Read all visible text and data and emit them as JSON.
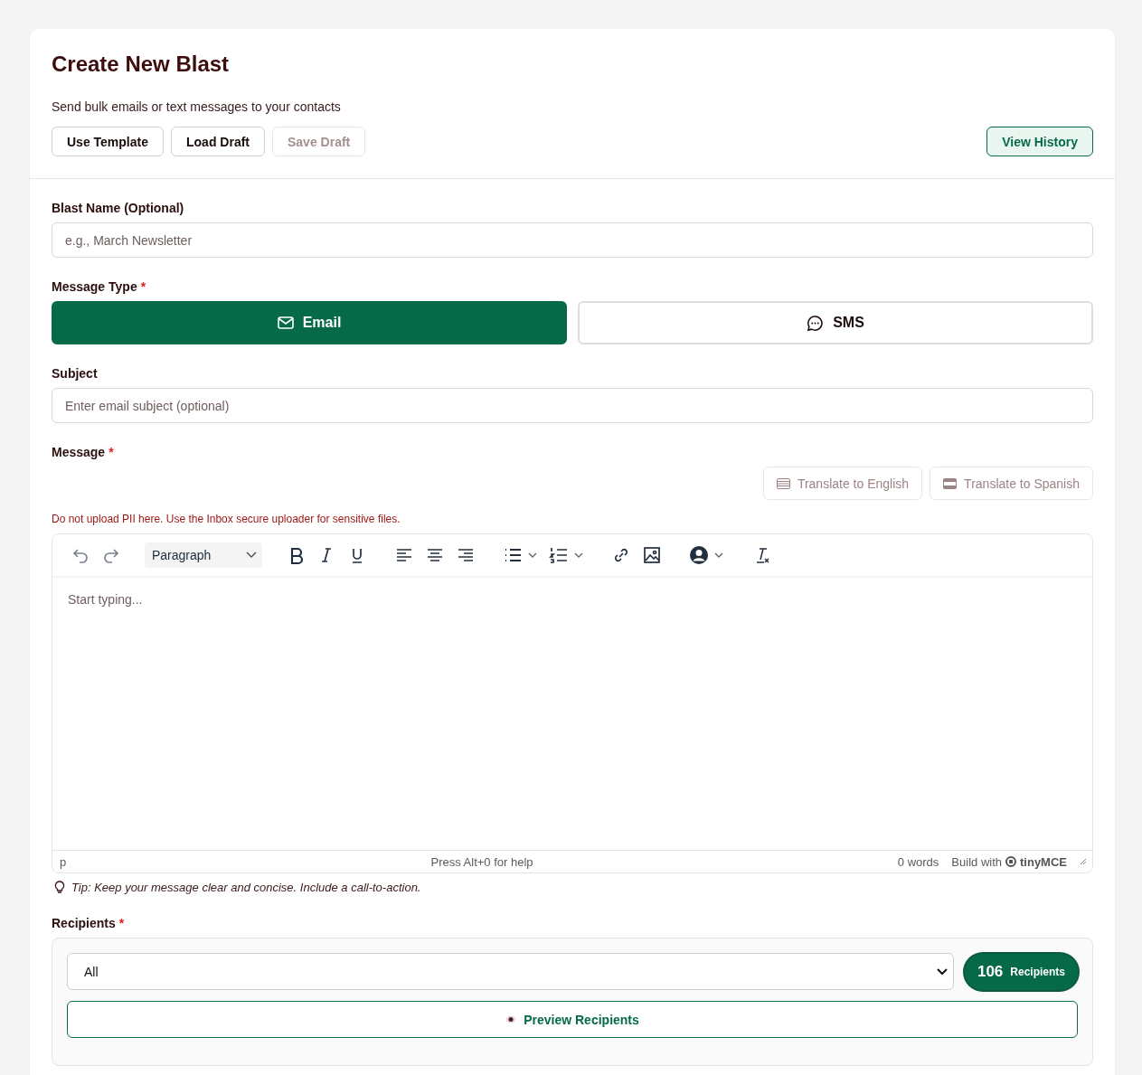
{
  "header": {
    "title": "Create New Blast",
    "subtitle": "Send bulk emails or text messages to your contacts",
    "actions": [
      {
        "label": "Use Template",
        "disabled": false
      },
      {
        "label": "Load Draft",
        "disabled": false
      },
      {
        "label": "Save Draft",
        "disabled": true
      }
    ],
    "history_button": "View History"
  },
  "blast_name": {
    "label": "Blast Name (Optional)",
    "placeholder": "e.g., March Newsletter"
  },
  "message_type": {
    "label": "Message Type",
    "required_mark": "*",
    "options": [
      {
        "label": "Email",
        "kind": "email",
        "selected": true
      },
      {
        "label": "SMS",
        "kind": "sms",
        "selected": false
      }
    ]
  },
  "subject": {
    "label": "Subject",
    "placeholder": "Enter email subject (optional)"
  },
  "message": {
    "label": "Message",
    "required_mark": "*",
    "translate_buttons": [
      {
        "label": "Translate to English",
        "kind": "english",
        "disabled": true
      },
      {
        "label": "Translate to Spanish",
        "kind": "spanish",
        "disabled": true
      }
    ],
    "warning": "Do not upload PII here. Use the Inbox secure uploader for sensitive files.",
    "editor": {
      "block_format": "Paragraph",
      "placeholder": "Start typing...",
      "path": "p",
      "help": "Press Alt+0 for help",
      "word_count": "0 words",
      "branding": "Build with",
      "brand": "tinyMCE"
    },
    "tip": "Tip: Keep your message clear and concise. Include a call-to-action."
  },
  "recipients": {
    "label": "Recipients",
    "required_mark": "*",
    "selection": "All",
    "count": "106",
    "count_label": "Recipients",
    "preview_button": "Preview Recipients"
  }
}
